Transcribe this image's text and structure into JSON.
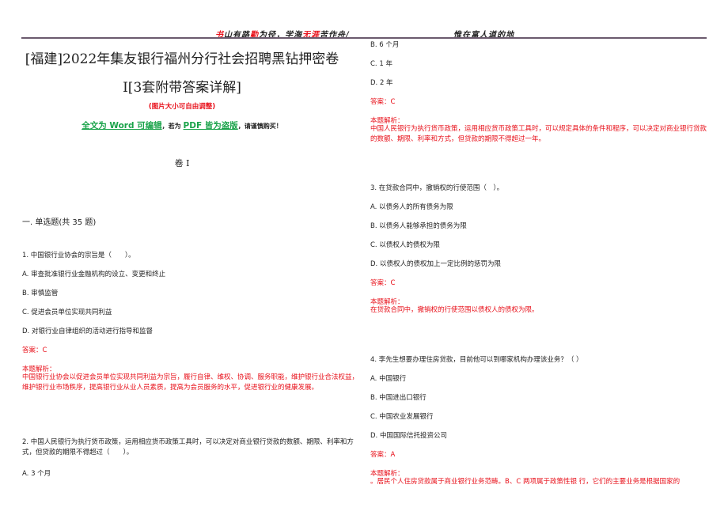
{
  "header": {
    "motto_left": [
      {
        "text": "书",
        "red": true
      },
      {
        "text": "山有路",
        "red": false
      },
      {
        "text": "勤",
        "red": true
      },
      {
        "text": "为径，学海",
        "red": false
      },
      {
        "text": "无涯",
        "red": true
      },
      {
        "text": "苦作舟/",
        "red": false
      }
    ],
    "motto_right": "惟在富人道的地"
  },
  "document": {
    "title_line1": "[福建]2022年集友银行福州分行社会招聘黑钻押密卷",
    "title_line2": "I[3套附带答案详解]",
    "resize_note": "(图片大小可自由调整)",
    "word_note": {
      "part1": "全文为 Word 可编辑",
      "part2": "，若为",
      "part3": "PDF 皆为盗版",
      "part4": "，请谨慎购买！"
    },
    "volume_label": "卷 I",
    "section_label": "一. 单选题(共 35 题)"
  },
  "questions": [
    {
      "stem": "1. 中国银行业协会的宗旨是（　　）。",
      "options": [
        "A. 审查批准银行业金融机构的设立、变更和终止",
        "B. 审慎监管",
        "C. 促进会员单位实现共同利益",
        "D. 对银行业自律组织的活动进行指导和监督"
      ],
      "answer": "答案：C",
      "explanation_title": "本题解析：",
      "explanation": "中国银行业协会以促进会员单位实现共同利益为宗旨，履行自律、维权、协调、服务职能，维护银行业合法权益，维护银行业市场秩序，提高银行业从业人员素质，提高为会员服务的水平，促进银行业的健康发展。"
    },
    {
      "stem": "2. 中国人民银行为执行货币政策，运用相应货币政策工具时，可以决定对商业银行贷款的数额、期限、利率和方式，但贷款的期限不得超过（　　）。",
      "options": [
        "A. 3 个月",
        "B. 6 个月",
        "C. 1 年",
        "D. 2 年"
      ],
      "answer": "答案：C",
      "explanation_title": "本题解析：",
      "explanation": "中国人民银行为执行货币政策，运用相应货币政策工具时，可以规定具体的条件和程序，可以决定对商业银行贷款的数额、期限、利率和方式，但贷款的期限不得超过一年。"
    },
    {
      "stem": "3.  在贷款合同中，撤销权的行使范围（　）。",
      "options": [
        "A. 以债务人的所有债务为限",
        "B. 以债务人能够承担的债务为限",
        "C. 以债权人的债权为限",
        "D. 以债权人的债权加上一定比例的惩罚为限"
      ],
      "answer": "答案：C",
      "explanation_title": "本题解析：",
      "explanation": "在贷款合同中，撤销权的行使范围以债权人的债权为限。"
    },
    {
      "stem": "4. 李先生想要办理住房贷款，目前他可以到哪家机构办理该业务？（ ）",
      "options": [
        "A. 中国银行",
        "B. 中国进出口银行",
        "C. 中国农业发展银行",
        "D. 中国国际信托投资公司"
      ],
      "answer": "答案：A",
      "explanation_title": "本题解析：",
      "explanation": "。居民个人住房贷款属于商业银行业务范畴。B、C 两项属于政策性银 行，它们的主要业务是根据国家的"
    }
  ]
}
